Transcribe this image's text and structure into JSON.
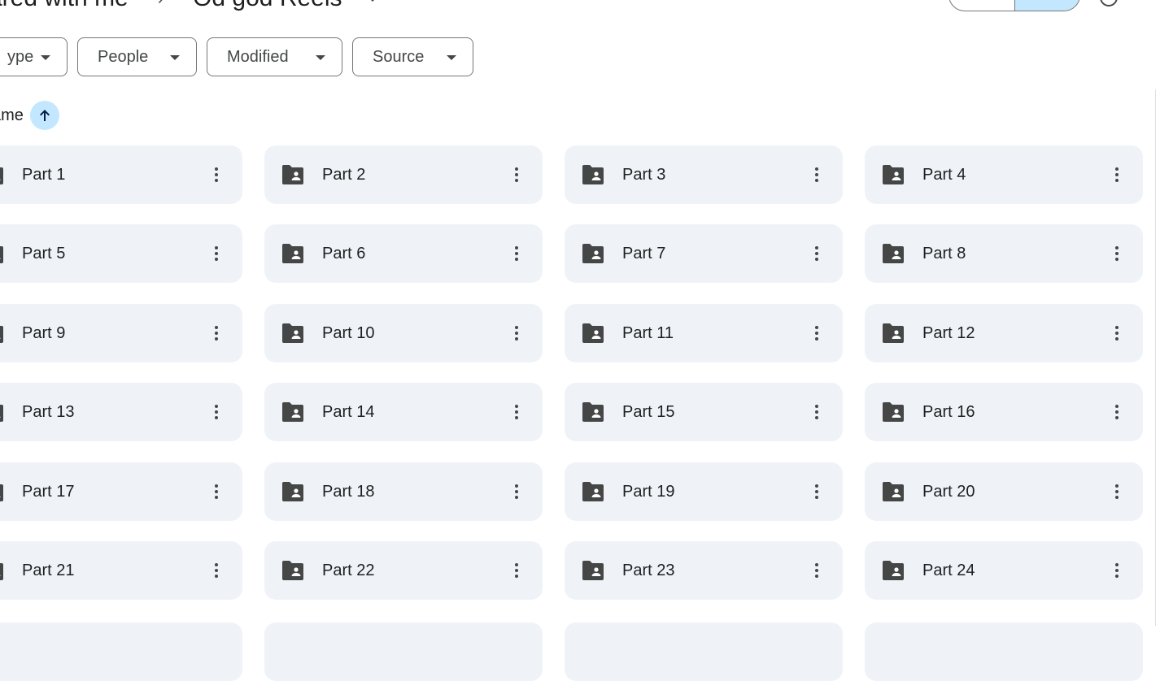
{
  "breadcrumb": {
    "parent": "ared with me",
    "current": "Od god Reels"
  },
  "filters": [
    {
      "label": "ype"
    },
    {
      "label": "People"
    },
    {
      "label": "Modified"
    },
    {
      "label": "Source"
    }
  ],
  "sort": {
    "label": "ame",
    "direction": "ascending"
  },
  "folders": [
    "Part 1",
    "Part 2",
    "Part 3",
    "Part 4",
    "Part 5",
    "Part 6",
    "Part 7",
    "Part 8",
    "Part 9",
    "Part 10",
    "Part 11",
    "Part 12",
    "Part 13",
    "Part 14",
    "Part 15",
    "Part 16",
    "Part 17",
    "Part 18",
    "Part 19",
    "Part 20",
    "Part 21",
    "Part 22",
    "Part 23",
    "Part 24"
  ],
  "colors": {
    "tile_bg": "#eff3f8",
    "active_toggle": "#c2e7ff",
    "icon": "#444746"
  }
}
